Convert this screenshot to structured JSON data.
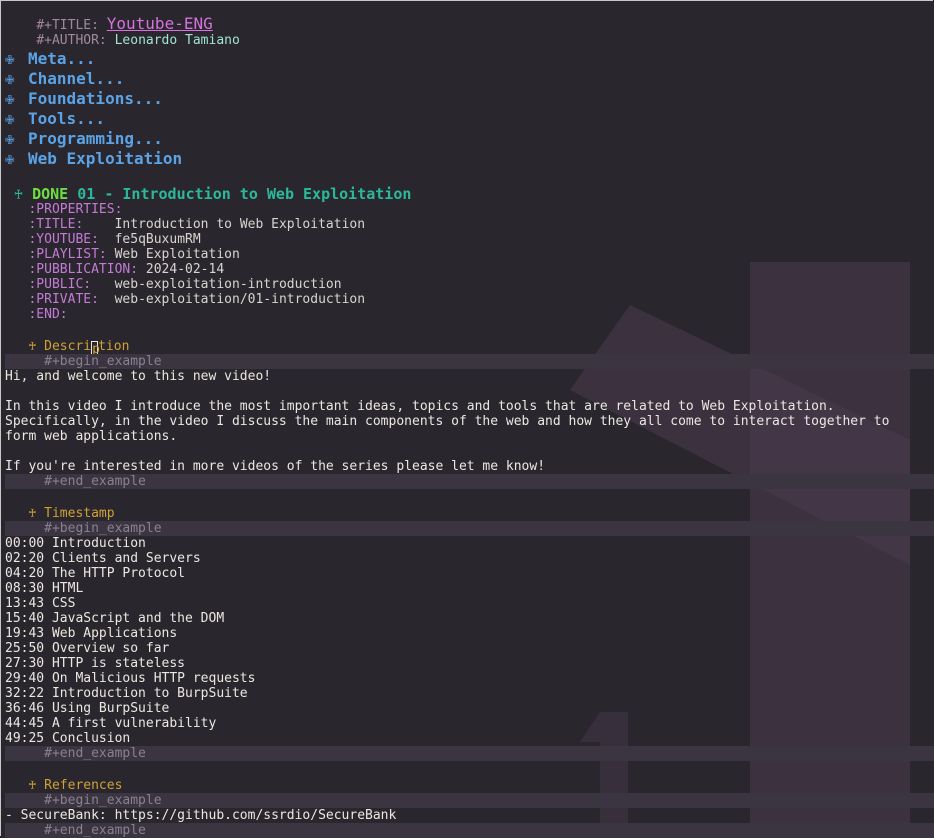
{
  "file": {
    "title_keyword": "#+TITLE:",
    "title_value": "Youtube-ENG",
    "author_keyword": "#+AUTHOR:",
    "author_value": "Leonardo Tamiano"
  },
  "headings": [
    {
      "bullet": "✙",
      "label": "Meta..."
    },
    {
      "bullet": "✙",
      "label": "Channel..."
    },
    {
      "bullet": "✙",
      "label": "Foundations..."
    },
    {
      "bullet": "✙",
      "label": "Tools..."
    },
    {
      "bullet": "✙",
      "label": "Programming..."
    },
    {
      "bullet": "✙",
      "label": "Web Exploitation"
    }
  ],
  "entry": {
    "bullet": "♰",
    "todo": "DONE",
    "title": "01 - Introduction to Web Exploitation",
    "properties_start": ":PROPERTIES:",
    "properties": [
      {
        "key": ":TITLE:",
        "pad": "    ",
        "value": "Introduction to Web Exploitation"
      },
      {
        "key": ":YOUTUBE:",
        "pad": "  ",
        "value": "fe5qBuxumRM"
      },
      {
        "key": ":PLAYLIST:",
        "pad": " ",
        "value": "Web Exploitation"
      },
      {
        "key": ":PUBBLICATION:",
        "pad": " ",
        "value": "2024-02-14"
      },
      {
        "key": ":PUBLIC:",
        "pad": "   ",
        "value": "web-exploitation-introduction"
      },
      {
        "key": ":PRIVATE:",
        "pad": "  ",
        "value": "web-exploitation/01-introduction"
      }
    ],
    "properties_end": ":END:"
  },
  "sections": {
    "bullet": "♰",
    "begin_example": "#+begin_example",
    "end_example": "#+end_example",
    "description": {
      "heading_pre": "Descri",
      "heading_cursor_char": "p",
      "heading_post": "tion",
      "lines": [
        "Hi, and welcome to this new video!",
        "",
        "In this video I introduce the most important ideas, topics and tools that are related to Web Exploitation.",
        "Specifically, in the video I discuss the main components of the web and how they all come to interact together to",
        "form web applications.",
        "",
        "If you're interested in more videos of the series please let me know!"
      ]
    },
    "timestamp": {
      "heading": "Timestamp",
      "lines": [
        "00:00 Introduction",
        "02:20 Clients and Servers",
        "04:20 The HTTP Protocol",
        "08:30 HTML",
        "13:43 CSS",
        "15:40 JavaScript and the DOM",
        "19:43 Web Applications",
        "25:50 Overview so far",
        "27:30 HTTP is stateless",
        "29:40 On Malicious HTTP requests",
        "32:22 Introduction to BurpSuite",
        "36:46 Using BurpSuite",
        "44:45 A first vulnerability",
        "49:25 Conclusion"
      ]
    },
    "references": {
      "heading": "References",
      "lines": [
        "- SecureBank: https://github.com/ssrdio/SecureBank"
      ]
    }
  },
  "colors": {
    "background": "#29272d",
    "heading_blue": "#5ca3e6",
    "done_green": "#6dde42",
    "entry_teal": "#2bb99b",
    "property_purple": "#c47ad6",
    "subheading_gold": "#cfa236",
    "title_magenta": "#d870e0"
  }
}
